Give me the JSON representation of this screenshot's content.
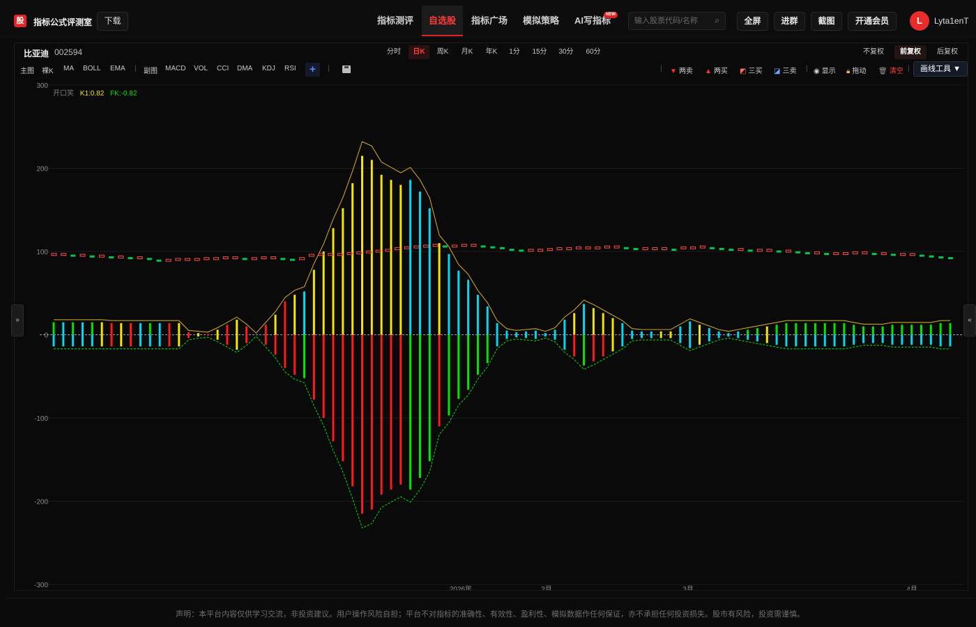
{
  "app": {
    "logo_text": "股",
    "title": "指标公式评测室",
    "download_label": "下载"
  },
  "nav": {
    "items": [
      {
        "label": "指标测评",
        "active": false
      },
      {
        "label": "自选股",
        "active": true
      },
      {
        "label": "指标广场",
        "active": false
      },
      {
        "label": "模拟策略",
        "active": false
      },
      {
        "label": "AI写指标",
        "active": false
      }
    ],
    "new_badge": "NEW"
  },
  "search": {
    "placeholder": "输入股票代码/名称",
    "value": ""
  },
  "top_buttons": {
    "fullscreen": "全屏",
    "join_group": "进群",
    "screenshot": "截图",
    "vip": "开通会员"
  },
  "user": {
    "avatar_letter": "L",
    "name": "Lyta1enT"
  },
  "stock": {
    "name": "比亚迪",
    "code": "002594"
  },
  "periods": [
    "分时",
    "日K",
    "周K",
    "月K",
    "年K",
    "1分",
    "15分",
    "30分",
    "60分"
  ],
  "active_period": "日K",
  "adjust": {
    "options": [
      "不复权",
      "前复权",
      "后复权"
    ],
    "active": "前复权"
  },
  "indicators": {
    "main_label": "主图",
    "main": [
      "裸K",
      "MA",
      "BOLL",
      "EMA"
    ],
    "sub_label": "副图",
    "sub": [
      "MACD",
      "VOL",
      "CCI",
      "DMA",
      "KDJ",
      "RSI"
    ],
    "add_label": "+"
  },
  "tools": {
    "two_sell": "两卖",
    "two_buy": "两买",
    "three_buy": "三买",
    "three_sell": "三卖",
    "show": "显示",
    "drag": "拖动",
    "clear": "清空",
    "draw_tools": "画线工具 ▼"
  },
  "legend": {
    "name": "开口笑",
    "k1": "K1:0.82",
    "fk": "FK:-0.82"
  },
  "colors": {
    "accent": "#e32424",
    "red": "#ff1a1a",
    "green": "#00e600",
    "yellow": "#f5e600",
    "cyan": "#00d8f0",
    "envelope": "#c9a227",
    "price_up": "#ff4d4d",
    "price_down": "#00c853"
  },
  "chart_data": {
    "type": "bar",
    "ylim": [
      -300,
      300
    ],
    "y_ticks": [
      300,
      200,
      100,
      0,
      -100,
      -200,
      -300
    ],
    "x_labels": [
      "2026年",
      "2月",
      "3月",
      "4月"
    ],
    "bar_colors_upper": [
      "green",
      "cyan",
      "green",
      "cyan",
      "green",
      "yellow",
      "red",
      "yellow",
      "red",
      "cyan",
      "green",
      "cyan",
      "red",
      "yellow",
      "red",
      "yellow",
      "red",
      "yellow",
      "red",
      "yellow",
      "red",
      "yellow",
      "red",
      "yellow",
      "red",
      "yellow",
      "cyan",
      "yellow",
      "yellow",
      "yellow",
      "yellow",
      "yellow",
      "yellow",
      "yellow",
      "yellow",
      "yellow",
      "yellow",
      "cyan",
      "cyan",
      "cyan",
      "yellow",
      "cyan",
      "cyan",
      "cyan",
      "cyan",
      "cyan",
      "cyan",
      "cyan",
      "cyan",
      "cyan",
      "cyan",
      "cyan",
      "cyan",
      "cyan",
      "yellow",
      "cyan",
      "yellow",
      "yellow",
      "yellow",
      "cyan",
      "cyan",
      "cyan",
      "cyan",
      "yellow",
      "yellow",
      "cyan",
      "cyan",
      "yellow",
      "cyan",
      "cyan",
      "cyan",
      "cyan",
      "green",
      "green",
      "yellow",
      "green",
      "green",
      "green",
      "green",
      "green",
      "green",
      "green",
      "green",
      "green",
      "green",
      "green",
      "green",
      "green",
      "green",
      "green",
      "green",
      "green",
      "green",
      "green"
    ],
    "upper_values": [
      15,
      15,
      15,
      15,
      15,
      15,
      14,
      14,
      14,
      14,
      14,
      14,
      14,
      14,
      3,
      2,
      1,
      6,
      12,
      18,
      10,
      0,
      12,
      24,
      40,
      48,
      52,
      78,
      100,
      128,
      152,
      182,
      215,
      210,
      192,
      186,
      180,
      186,
      172,
      152,
      110,
      97,
      77,
      66,
      48,
      34,
      14,
      5,
      3,
      4,
      5,
      2,
      6,
      18,
      26,
      37,
      32,
      26,
      20,
      14,
      5,
      4,
      4,
      4,
      4,
      10,
      16,
      12,
      8,
      4,
      2,
      4,
      6,
      8,
      10,
      12,
      14,
      14,
      14,
      14,
      14,
      14,
      14,
      12,
      10,
      10,
      10,
      12,
      12,
      12,
      12,
      12,
      14,
      14
    ],
    "lower_values": [
      -14,
      -14,
      -14,
      -14,
      -14,
      -14,
      -14,
      -14,
      -14,
      -14,
      -14,
      -14,
      -14,
      -14,
      -4,
      -2,
      -1,
      -6,
      -12,
      -18,
      -10,
      0,
      -12,
      -24,
      -40,
      -48,
      -52,
      -78,
      -100,
      -128,
      -152,
      -182,
      -215,
      -210,
      -192,
      -186,
      -180,
      -186,
      -172,
      -152,
      -110,
      -97,
      -77,
      -66,
      -48,
      -34,
      -14,
      -5,
      -3,
      -4,
      -5,
      -2,
      -6,
      -18,
      -26,
      -37,
      -32,
      -26,
      -20,
      -14,
      -5,
      -4,
      -4,
      -4,
      -4,
      -10,
      -16,
      -12,
      -8,
      -4,
      -2,
      -4,
      -6,
      -8,
      -10,
      -12,
      -14,
      -14,
      -14,
      -14,
      -14,
      -14,
      -14,
      -12,
      -10,
      -10,
      -10,
      -12,
      -12,
      -12,
      -12,
      -12,
      -14,
      -14
    ],
    "price_series": [
      96,
      96,
      95,
      95,
      94,
      94,
      93,
      93,
      92,
      92,
      91,
      89,
      89,
      90,
      90,
      90,
      91,
      91,
      92,
      92,
      91,
      91,
      92,
      92,
      91,
      90,
      91,
      95,
      96,
      96,
      96,
      97,
      98,
      99,
      100,
      101,
      103,
      104,
      105,
      106,
      107,
      106,
      106,
      107,
      107,
      106,
      105,
      104,
      102,
      101,
      101,
      101,
      102,
      103,
      103,
      104,
      104,
      104,
      105,
      105,
      104,
      103,
      103,
      103,
      103,
      102,
      104,
      104,
      105,
      104,
      103,
      102,
      102,
      101,
      101,
      101,
      100,
      100,
      99,
      98,
      98,
      97,
      97,
      97,
      98,
      98,
      97,
      97,
      96,
      96,
      96,
      95,
      94,
      93,
      92
    ]
  }
}
